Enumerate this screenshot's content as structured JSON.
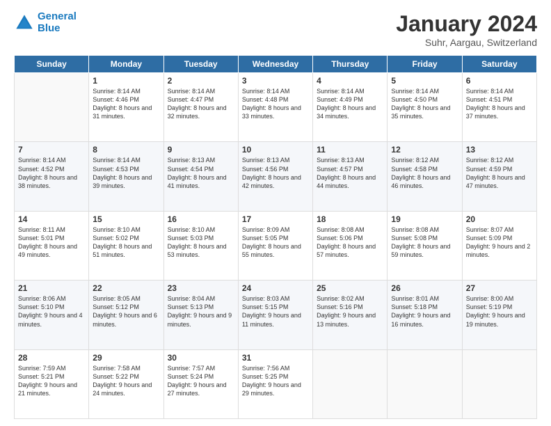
{
  "logo": {
    "line1": "General",
    "line2": "Blue"
  },
  "title": "January 2024",
  "subtitle": "Suhr, Aargau, Switzerland",
  "days_of_week": [
    "Sunday",
    "Monday",
    "Tuesday",
    "Wednesday",
    "Thursday",
    "Friday",
    "Saturday"
  ],
  "weeks": [
    [
      {
        "num": "",
        "sunrise": "",
        "sunset": "",
        "daylight": ""
      },
      {
        "num": "1",
        "sunrise": "Sunrise: 8:14 AM",
        "sunset": "Sunset: 4:46 PM",
        "daylight": "Daylight: 8 hours and 31 minutes."
      },
      {
        "num": "2",
        "sunrise": "Sunrise: 8:14 AM",
        "sunset": "Sunset: 4:47 PM",
        "daylight": "Daylight: 8 hours and 32 minutes."
      },
      {
        "num": "3",
        "sunrise": "Sunrise: 8:14 AM",
        "sunset": "Sunset: 4:48 PM",
        "daylight": "Daylight: 8 hours and 33 minutes."
      },
      {
        "num": "4",
        "sunrise": "Sunrise: 8:14 AM",
        "sunset": "Sunset: 4:49 PM",
        "daylight": "Daylight: 8 hours and 34 minutes."
      },
      {
        "num": "5",
        "sunrise": "Sunrise: 8:14 AM",
        "sunset": "Sunset: 4:50 PM",
        "daylight": "Daylight: 8 hours and 35 minutes."
      },
      {
        "num": "6",
        "sunrise": "Sunrise: 8:14 AM",
        "sunset": "Sunset: 4:51 PM",
        "daylight": "Daylight: 8 hours and 37 minutes."
      }
    ],
    [
      {
        "num": "7",
        "sunrise": "Sunrise: 8:14 AM",
        "sunset": "Sunset: 4:52 PM",
        "daylight": "Daylight: 8 hours and 38 minutes."
      },
      {
        "num": "8",
        "sunrise": "Sunrise: 8:14 AM",
        "sunset": "Sunset: 4:53 PM",
        "daylight": "Daylight: 8 hours and 39 minutes."
      },
      {
        "num": "9",
        "sunrise": "Sunrise: 8:13 AM",
        "sunset": "Sunset: 4:54 PM",
        "daylight": "Daylight: 8 hours and 41 minutes."
      },
      {
        "num": "10",
        "sunrise": "Sunrise: 8:13 AM",
        "sunset": "Sunset: 4:56 PM",
        "daylight": "Daylight: 8 hours and 42 minutes."
      },
      {
        "num": "11",
        "sunrise": "Sunrise: 8:13 AM",
        "sunset": "Sunset: 4:57 PM",
        "daylight": "Daylight: 8 hours and 44 minutes."
      },
      {
        "num": "12",
        "sunrise": "Sunrise: 8:12 AM",
        "sunset": "Sunset: 4:58 PM",
        "daylight": "Daylight: 8 hours and 46 minutes."
      },
      {
        "num": "13",
        "sunrise": "Sunrise: 8:12 AM",
        "sunset": "Sunset: 4:59 PM",
        "daylight": "Daylight: 8 hours and 47 minutes."
      }
    ],
    [
      {
        "num": "14",
        "sunrise": "Sunrise: 8:11 AM",
        "sunset": "Sunset: 5:01 PM",
        "daylight": "Daylight: 8 hours and 49 minutes."
      },
      {
        "num": "15",
        "sunrise": "Sunrise: 8:10 AM",
        "sunset": "Sunset: 5:02 PM",
        "daylight": "Daylight: 8 hours and 51 minutes."
      },
      {
        "num": "16",
        "sunrise": "Sunrise: 8:10 AM",
        "sunset": "Sunset: 5:03 PM",
        "daylight": "Daylight: 8 hours and 53 minutes."
      },
      {
        "num": "17",
        "sunrise": "Sunrise: 8:09 AM",
        "sunset": "Sunset: 5:05 PM",
        "daylight": "Daylight: 8 hours and 55 minutes."
      },
      {
        "num": "18",
        "sunrise": "Sunrise: 8:08 AM",
        "sunset": "Sunset: 5:06 PM",
        "daylight": "Daylight: 8 hours and 57 minutes."
      },
      {
        "num": "19",
        "sunrise": "Sunrise: 8:08 AM",
        "sunset": "Sunset: 5:08 PM",
        "daylight": "Daylight: 8 hours and 59 minutes."
      },
      {
        "num": "20",
        "sunrise": "Sunrise: 8:07 AM",
        "sunset": "Sunset: 5:09 PM",
        "daylight": "Daylight: 9 hours and 2 minutes."
      }
    ],
    [
      {
        "num": "21",
        "sunrise": "Sunrise: 8:06 AM",
        "sunset": "Sunset: 5:10 PM",
        "daylight": "Daylight: 9 hours and 4 minutes."
      },
      {
        "num": "22",
        "sunrise": "Sunrise: 8:05 AM",
        "sunset": "Sunset: 5:12 PM",
        "daylight": "Daylight: 9 hours and 6 minutes."
      },
      {
        "num": "23",
        "sunrise": "Sunrise: 8:04 AM",
        "sunset": "Sunset: 5:13 PM",
        "daylight": "Daylight: 9 hours and 9 minutes."
      },
      {
        "num": "24",
        "sunrise": "Sunrise: 8:03 AM",
        "sunset": "Sunset: 5:15 PM",
        "daylight": "Daylight: 9 hours and 11 minutes."
      },
      {
        "num": "25",
        "sunrise": "Sunrise: 8:02 AM",
        "sunset": "Sunset: 5:16 PM",
        "daylight": "Daylight: 9 hours and 13 minutes."
      },
      {
        "num": "26",
        "sunrise": "Sunrise: 8:01 AM",
        "sunset": "Sunset: 5:18 PM",
        "daylight": "Daylight: 9 hours and 16 minutes."
      },
      {
        "num": "27",
        "sunrise": "Sunrise: 8:00 AM",
        "sunset": "Sunset: 5:19 PM",
        "daylight": "Daylight: 9 hours and 19 minutes."
      }
    ],
    [
      {
        "num": "28",
        "sunrise": "Sunrise: 7:59 AM",
        "sunset": "Sunset: 5:21 PM",
        "daylight": "Daylight: 9 hours and 21 minutes."
      },
      {
        "num": "29",
        "sunrise": "Sunrise: 7:58 AM",
        "sunset": "Sunset: 5:22 PM",
        "daylight": "Daylight: 9 hours and 24 minutes."
      },
      {
        "num": "30",
        "sunrise": "Sunrise: 7:57 AM",
        "sunset": "Sunset: 5:24 PM",
        "daylight": "Daylight: 9 hours and 27 minutes."
      },
      {
        "num": "31",
        "sunrise": "Sunrise: 7:56 AM",
        "sunset": "Sunset: 5:25 PM",
        "daylight": "Daylight: 9 hours and 29 minutes."
      },
      {
        "num": "",
        "sunrise": "",
        "sunset": "",
        "daylight": ""
      },
      {
        "num": "",
        "sunrise": "",
        "sunset": "",
        "daylight": ""
      },
      {
        "num": "",
        "sunrise": "",
        "sunset": "",
        "daylight": ""
      }
    ]
  ]
}
